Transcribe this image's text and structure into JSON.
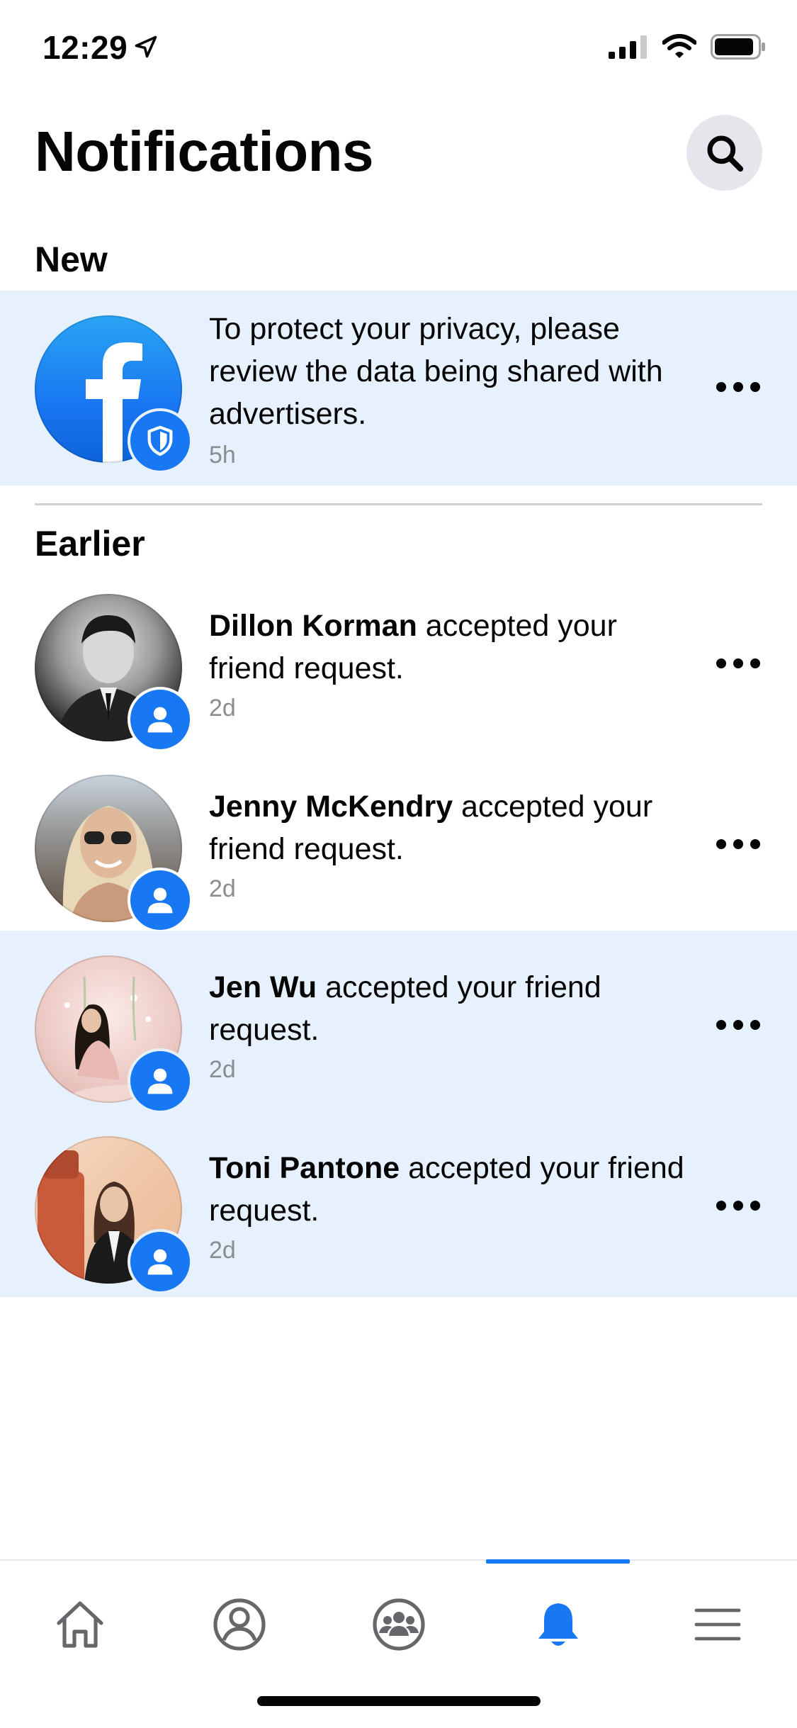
{
  "status_bar": {
    "time": "12:29"
  },
  "header": {
    "title": "Notifications"
  },
  "sections": {
    "new_label": "New",
    "earlier_label": "Earlier"
  },
  "new_notifications": [
    {
      "text": "To protect your privacy, please review the data being shared with advertisers.",
      "time": "5h",
      "avatar": "facebook-logo",
      "badge": "shield-icon"
    }
  ],
  "earlier_notifications": [
    {
      "name": "Dillon Korman",
      "action": " accepted your friend request.",
      "time": "2d",
      "badge": "person-icon",
      "unread": false
    },
    {
      "name": "Jenny McKendry",
      "action": " accepted your friend request.",
      "time": "2d",
      "badge": "person-icon",
      "unread": false
    },
    {
      "name": "Jen Wu",
      "action": " accepted your friend request.",
      "time": "2d",
      "badge": "person-icon",
      "unread": true
    },
    {
      "name": "Toni Pantone",
      "action": " accepted your friend request.",
      "time": "2d",
      "badge": "person-icon",
      "unread": true
    }
  ],
  "tab_bar": {
    "tabs": [
      {
        "icon": "home-icon",
        "active": false
      },
      {
        "icon": "profile-icon",
        "active": false
      },
      {
        "icon": "groups-icon",
        "active": false
      },
      {
        "icon": "bell-icon",
        "active": true
      },
      {
        "icon": "menu-icon",
        "active": false
      }
    ]
  },
  "colors": {
    "brand": "#1877f2",
    "unread_bg": "#e7f0fd",
    "text": "#050505",
    "secondary_text": "#8a8d91"
  }
}
